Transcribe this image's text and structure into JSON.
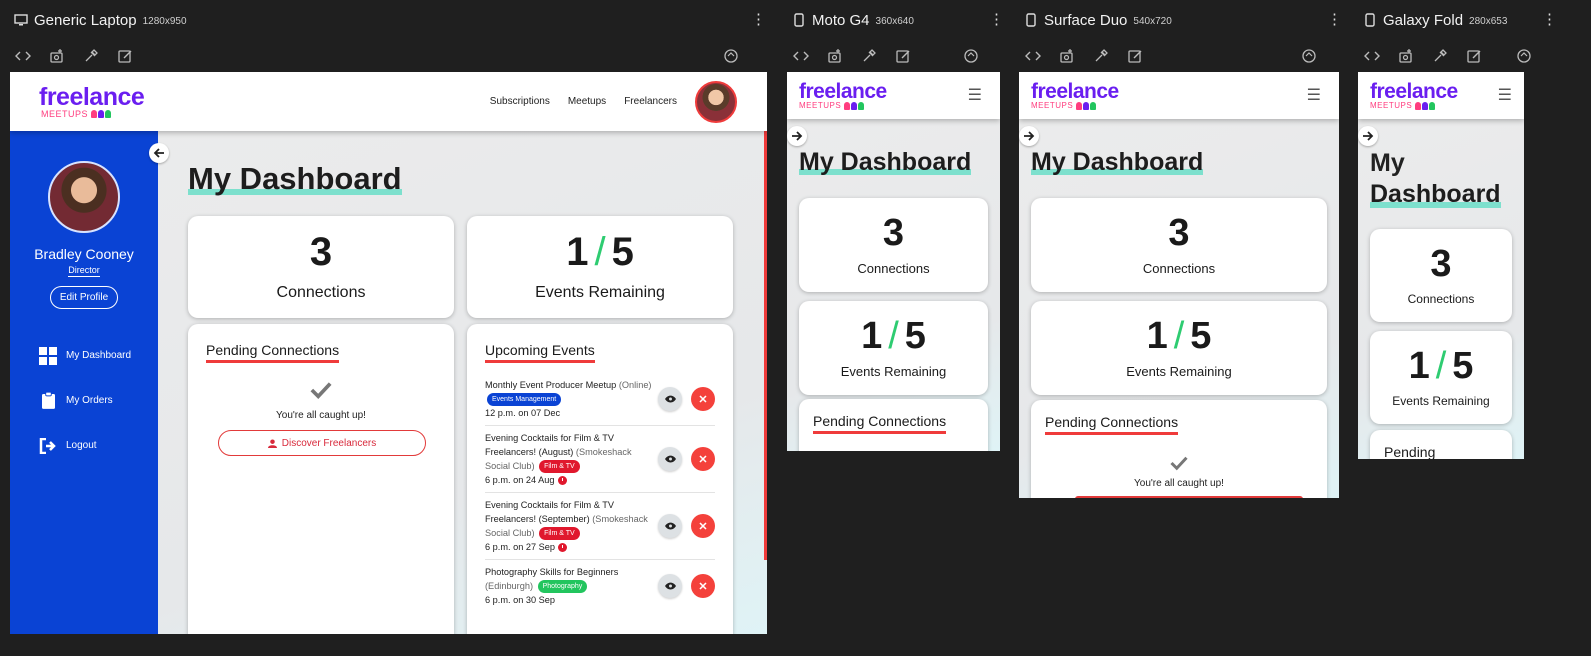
{
  "devices": [
    {
      "name": "Generic Laptop",
      "size": "1280x950"
    },
    {
      "name": "Moto G4",
      "size": "360x640"
    },
    {
      "name": "Surface Duo",
      "size": "540x720"
    },
    {
      "name": "Galaxy Fold",
      "size": "280x653"
    }
  ],
  "toolbar_icons": [
    "code-icon",
    "screenshot-icon",
    "eyedropper-icon",
    "edit-icon",
    "rotate-icon"
  ],
  "brand": {
    "name": "freelance",
    "sub": "MEETUPS",
    "primary": "#6a1ef0",
    "accent": "#ff3d7f"
  },
  "nav": {
    "subscriptions": "Subscriptions",
    "meetups": "Meetups",
    "freelancers": "Freelancers"
  },
  "profile": {
    "name": "Bradley Cooney",
    "role": "Director",
    "edit_label": "Edit Profile"
  },
  "sidebar_menu": [
    {
      "label": "My Dashboard",
      "icon": "grid-icon"
    },
    {
      "label": "My Orders",
      "icon": "clipboard-icon"
    },
    {
      "label": "Logout",
      "icon": "logout-icon"
    }
  ],
  "dashboard": {
    "title": "My Dashboard",
    "title_wrapped": [
      "My",
      "Dashboard"
    ],
    "connections_count": "3",
    "connections_label": "Connections",
    "events_used": "1",
    "events_slash": "/",
    "events_total": "5",
    "events_label": "Events Remaining"
  },
  "pending": {
    "title": "Pending Connections",
    "title_cut": "Pending",
    "empty_message": "You're all caught up!",
    "discover_label": "Discover Freelancers"
  },
  "upcoming": {
    "title": "Upcoming Events",
    "on": "on",
    "events": [
      {
        "title": "Monthly Event Producer Meetup",
        "location": "(Online)",
        "tag": "Events Management",
        "tag_color": "#0a43d4",
        "time": "12 p.m.",
        "date": "07 Dec",
        "soon": false
      },
      {
        "title": "Evening Cocktails for Film & TV Freelancers! (August)",
        "location": "(Smokeshack Social Club)",
        "tag": "Film & TV",
        "tag_color": "#e0182d",
        "time": "6 p.m.",
        "date": "24 Aug",
        "soon": true
      },
      {
        "title": "Evening Cocktails for Film & TV Freelancers! (September)",
        "location": "(Smokeshack Social Club)",
        "tag": "Film & TV",
        "tag_color": "#e0182d",
        "time": "6 p.m.",
        "date": "27 Sep",
        "soon": true
      },
      {
        "title": "Photography Skills for Beginners",
        "location": "(Edinburgh)",
        "tag": "Photography",
        "tag_color": "#22c55e",
        "time": "6 p.m.",
        "date": "30 Sep",
        "soon": false
      }
    ]
  },
  "colors": {
    "sidebar_blue": "#0a43d4",
    "danger_red": "#ef3b3b",
    "slash_green": "#2ecc71",
    "highlight_teal": "#7de0cd"
  }
}
